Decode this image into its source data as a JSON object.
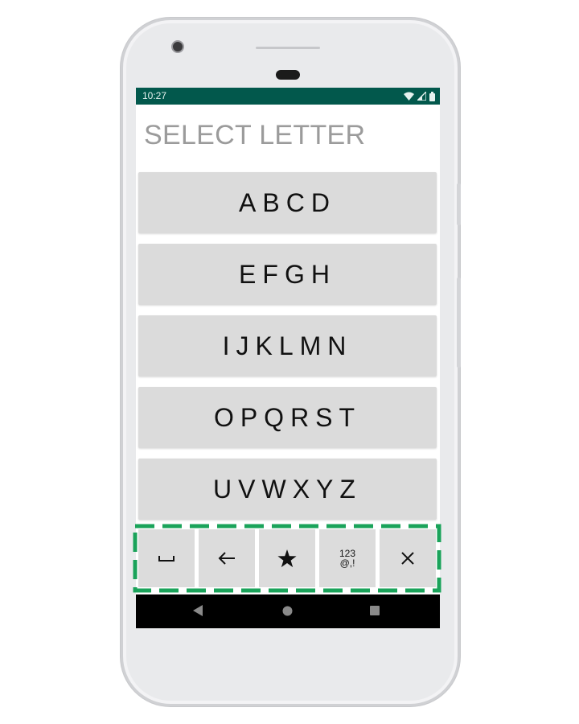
{
  "status_bar": {
    "time": "10:27",
    "icons": [
      "wifi-icon",
      "signal-icon",
      "battery-icon"
    ]
  },
  "screen_title": "SELECT LETTER",
  "letter_groups": [
    {
      "label": "ABCD"
    },
    {
      "label": "EFGH"
    },
    {
      "label": "IJKLMN"
    },
    {
      "label": "OPQRST"
    },
    {
      "label": "UVWXYZ"
    }
  ],
  "toolbar": {
    "buttons": [
      {
        "name": "space-icon"
      },
      {
        "name": "backspace-arrow-icon"
      },
      {
        "name": "star-icon"
      },
      {
        "name": "numbers-symbols-icon",
        "line1": "123",
        "line2": "@,!"
      },
      {
        "name": "close-icon"
      }
    ],
    "highlight_color": "#1aa35a"
  },
  "nav_bar": {
    "icons": [
      "back-icon",
      "home-icon",
      "recents-icon"
    ]
  },
  "colors": {
    "status_bar": "#02584c",
    "button_bg": "#dbdbdb",
    "title": "#9b9b9b"
  }
}
